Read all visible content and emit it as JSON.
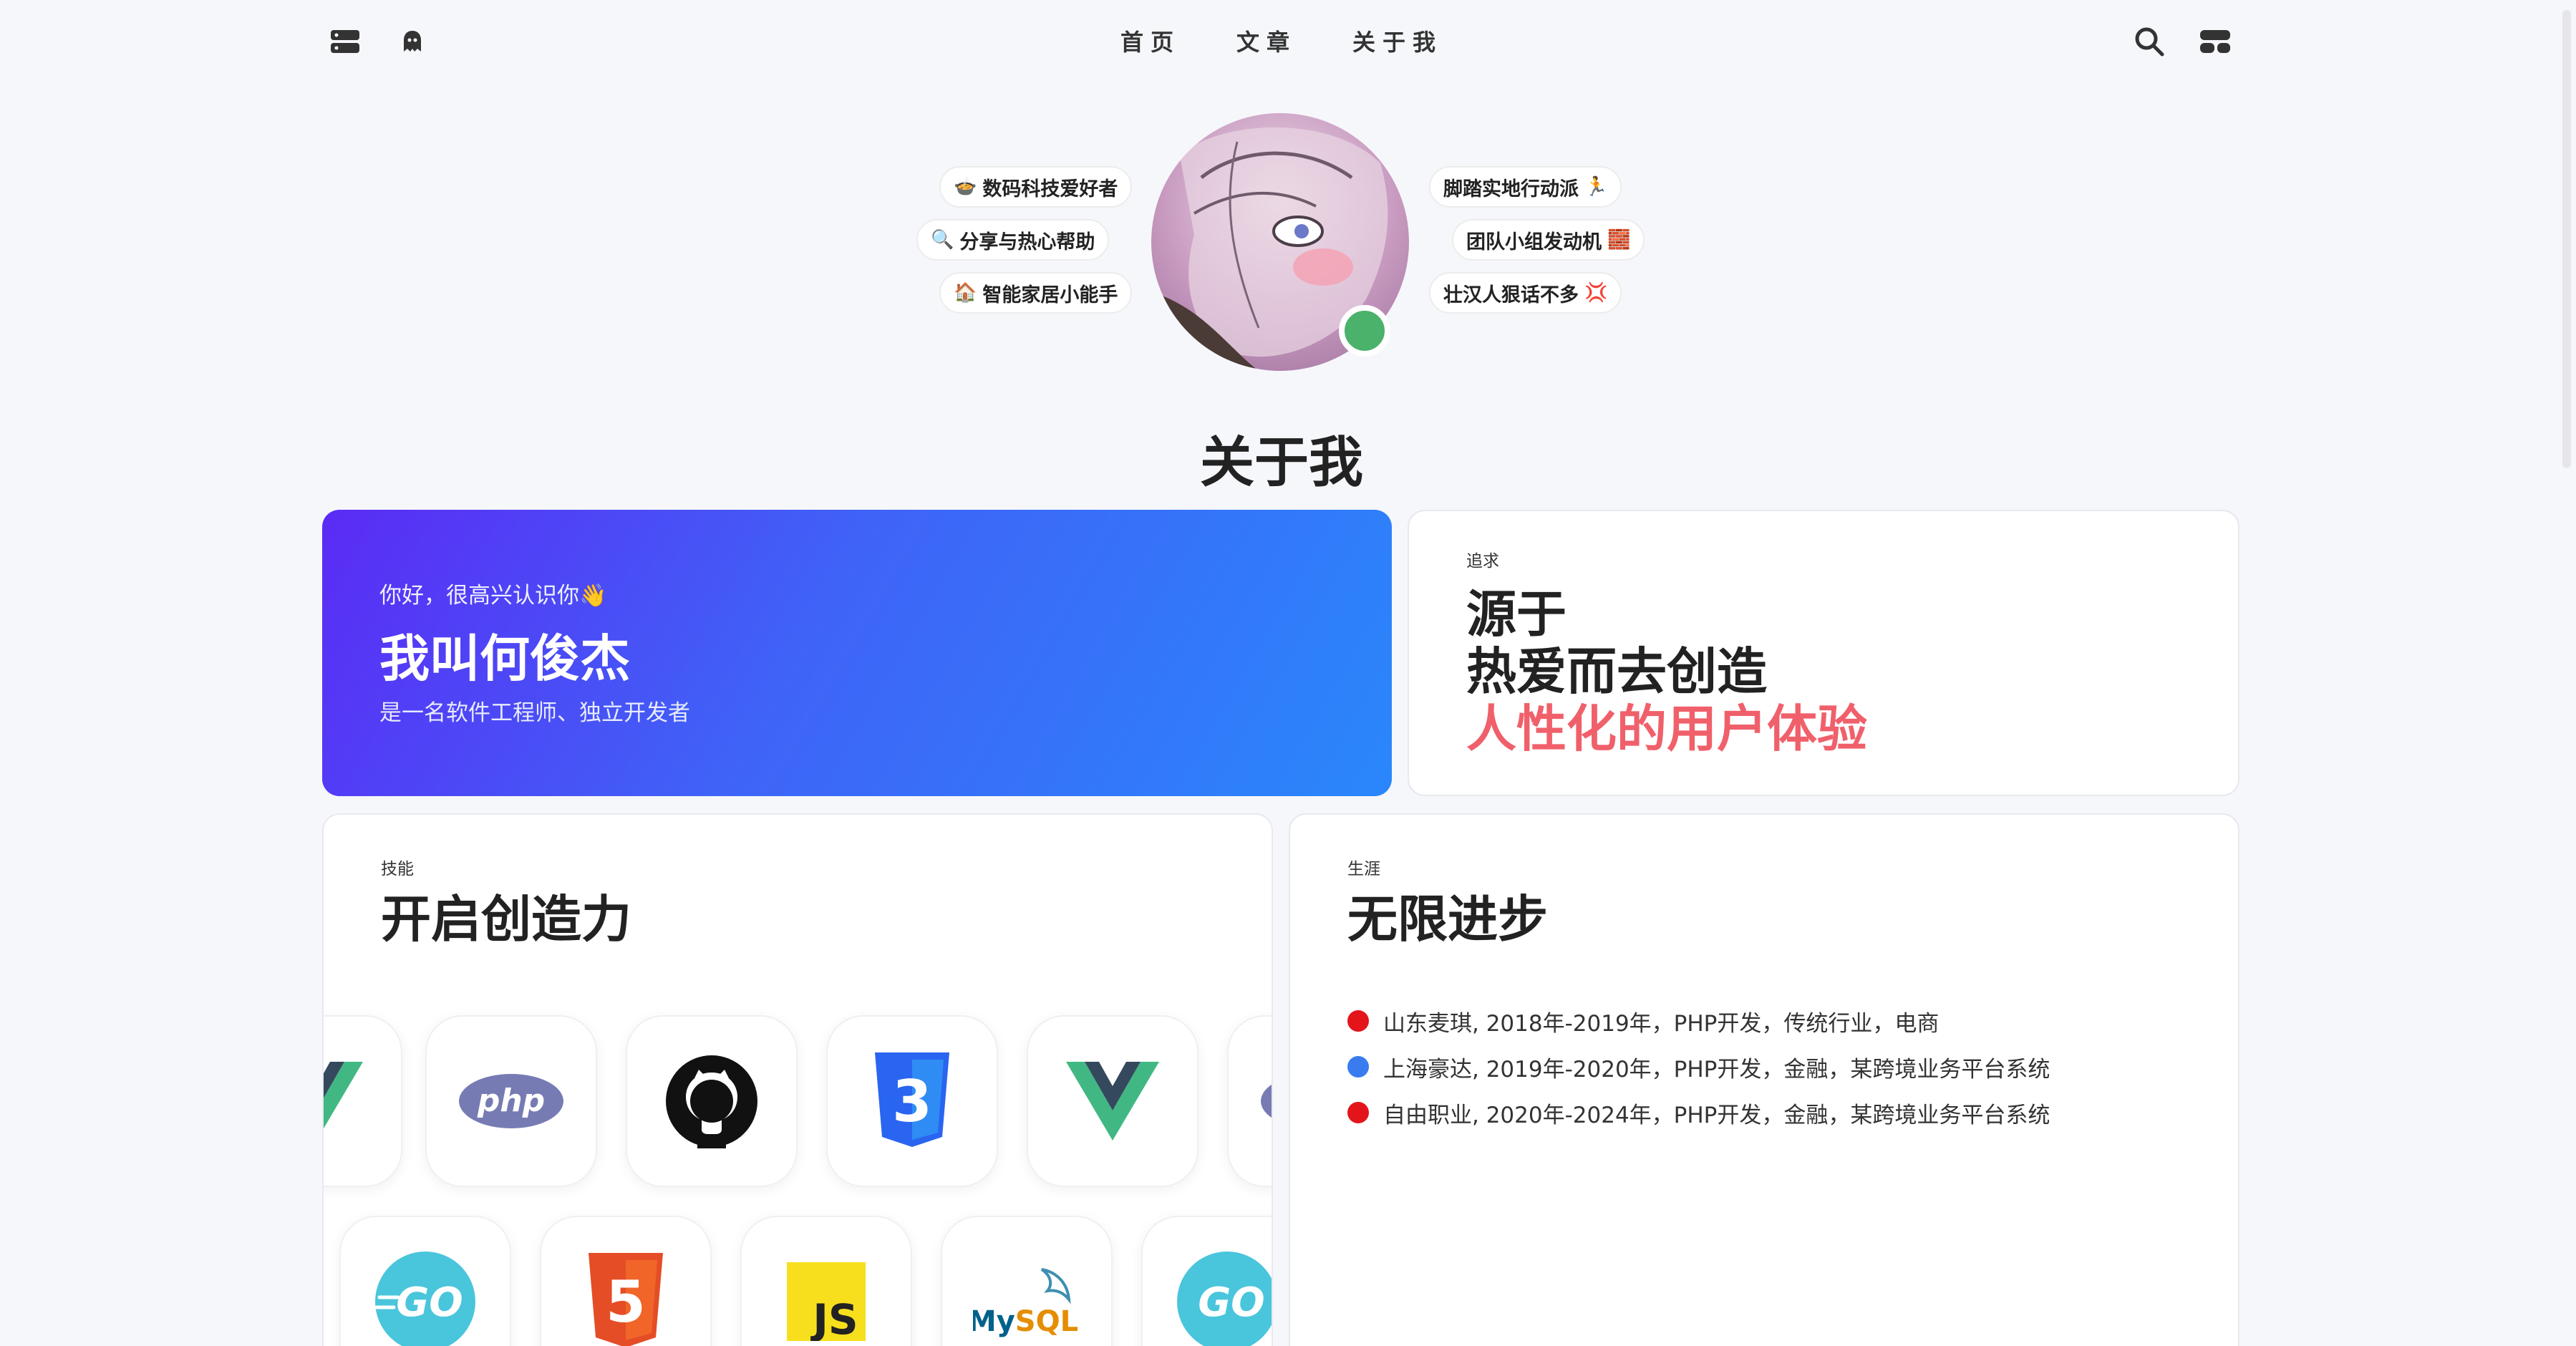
{
  "nav": {
    "links": [
      "首页",
      "文章",
      "关于我"
    ]
  },
  "hero": {
    "tags_left": [
      {
        "emoji": "🍲",
        "label": "数码科技爱好者"
      },
      {
        "emoji": "🔍",
        "label": "分享与热心帮助"
      },
      {
        "emoji": "🏠",
        "label": "智能家居小能手"
      }
    ],
    "tags_right": [
      {
        "emoji": "🏃",
        "label": "脚踏实地行动派"
      },
      {
        "emoji": "🧱",
        "label": "团队小组发动机"
      },
      {
        "emoji": "💢",
        "label": "壮汉人狠话不多"
      }
    ],
    "title": "关于我"
  },
  "intro_card": {
    "greeting": "你好，很高兴认识你👋",
    "name": "我叫何俊杰",
    "description": "是一名软件工程师、独立开发者"
  },
  "pursuit_card": {
    "label": "追求",
    "line1": "源于",
    "line2": "热爱而去创造",
    "line3": "人性化的用户体验"
  },
  "skills_card": {
    "label": "技能",
    "title": "开启创造力",
    "row1": [
      "vue-icon",
      "php-icon",
      "github-icon",
      "css3-icon",
      "vue-icon",
      "php-icon"
    ],
    "row2": [
      "go-icon",
      "html5-icon",
      "js-icon",
      "mysql-icon",
      "go-icon"
    ]
  },
  "career_card": {
    "label": "生涯",
    "title": "无限进步",
    "items": [
      {
        "color": "#e4141b",
        "text": "山东麦琪, 2018年-2019年，PHP开发，传统行业，电商"
      },
      {
        "color": "#3a7bf0",
        "text": "上海豪达, 2019年-2020年，PHP开发，金融，某跨境业务平台系统"
      },
      {
        "color": "#e4141b",
        "text": "自由职业, 2020年-2024年，PHP开发，金融，某跨境业务平台系统"
      }
    ]
  }
}
